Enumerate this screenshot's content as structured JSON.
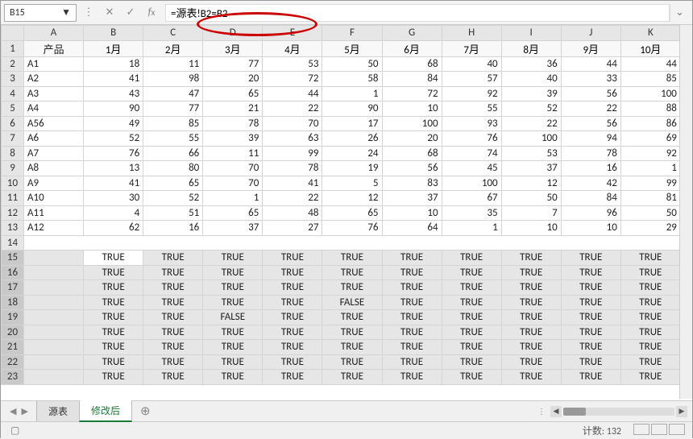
{
  "cell_ref": "B15",
  "formula": "=源表!B2=B2",
  "columns": [
    "A",
    "B",
    "C",
    "D",
    "E",
    "F",
    "G",
    "H",
    "I",
    "J",
    "K"
  ],
  "headers": [
    "产品",
    "1月",
    "2月",
    "3月",
    "4月",
    "5月",
    "6月",
    "7月",
    "8月",
    "9月",
    "10月"
  ],
  "rows": [
    [
      "A1",
      18,
      11,
      77,
      53,
      50,
      68,
      40,
      36,
      44,
      44
    ],
    [
      "A2",
      41,
      98,
      20,
      72,
      58,
      84,
      57,
      40,
      33,
      85
    ],
    [
      "A3",
      43,
      47,
      65,
      44,
      1,
      72,
      92,
      39,
      56,
      100
    ],
    [
      "A4",
      90,
      77,
      21,
      22,
      90,
      10,
      55,
      52,
      22,
      88
    ],
    [
      "A56",
      49,
      85,
      78,
      70,
      17,
      100,
      93,
      22,
      56,
      86
    ],
    [
      "A6",
      52,
      55,
      39,
      63,
      26,
      20,
      76,
      100,
      94,
      69
    ],
    [
      "A7",
      76,
      66,
      11,
      99,
      24,
      68,
      74,
      53,
      78,
      92
    ],
    [
      "A8",
      13,
      80,
      70,
      78,
      19,
      56,
      45,
      37,
      16,
      1
    ],
    [
      "A9",
      41,
      65,
      70,
      41,
      5,
      83,
      100,
      12,
      42,
      99
    ],
    [
      "A10",
      30,
      52,
      1,
      22,
      12,
      37,
      67,
      50,
      84,
      81
    ],
    [
      "A11",
      4,
      51,
      65,
      48,
      65,
      10,
      35,
      7,
      96,
      50
    ],
    [
      "A12",
      62,
      16,
      37,
      27,
      76,
      64,
      1,
      10,
      10,
      29
    ]
  ],
  "bool_rows": [
    [
      "TRUE",
      "TRUE",
      "TRUE",
      "TRUE",
      "TRUE",
      "TRUE",
      "TRUE",
      "TRUE",
      "TRUE",
      "TRUE"
    ],
    [
      "TRUE",
      "TRUE",
      "TRUE",
      "TRUE",
      "TRUE",
      "TRUE",
      "TRUE",
      "TRUE",
      "TRUE",
      "TRUE"
    ],
    [
      "TRUE",
      "TRUE",
      "TRUE",
      "TRUE",
      "TRUE",
      "TRUE",
      "TRUE",
      "TRUE",
      "TRUE",
      "TRUE"
    ],
    [
      "TRUE",
      "TRUE",
      "TRUE",
      "TRUE",
      "FALSE",
      "TRUE",
      "TRUE",
      "TRUE",
      "TRUE",
      "TRUE"
    ],
    [
      "TRUE",
      "TRUE",
      "FALSE",
      "TRUE",
      "TRUE",
      "TRUE",
      "TRUE",
      "TRUE",
      "TRUE",
      "TRUE"
    ],
    [
      "TRUE",
      "TRUE",
      "TRUE",
      "TRUE",
      "TRUE",
      "TRUE",
      "TRUE",
      "TRUE",
      "TRUE",
      "TRUE"
    ],
    [
      "TRUE",
      "TRUE",
      "TRUE",
      "TRUE",
      "TRUE",
      "TRUE",
      "TRUE",
      "TRUE",
      "TRUE",
      "TRUE"
    ],
    [
      "TRUE",
      "TRUE",
      "TRUE",
      "TRUE",
      "TRUE",
      "TRUE",
      "TRUE",
      "TRUE",
      "TRUE",
      "TRUE"
    ],
    [
      "TRUE",
      "TRUE",
      "TRUE",
      "TRUE",
      "TRUE",
      "TRUE",
      "TRUE",
      "TRUE",
      "TRUE",
      "TRUE"
    ]
  ],
  "tabs": {
    "t1": "源表",
    "t2": "修改后"
  },
  "status": {
    "count_label": "计数:",
    "count_value": "132"
  },
  "col_right_edge": "1"
}
